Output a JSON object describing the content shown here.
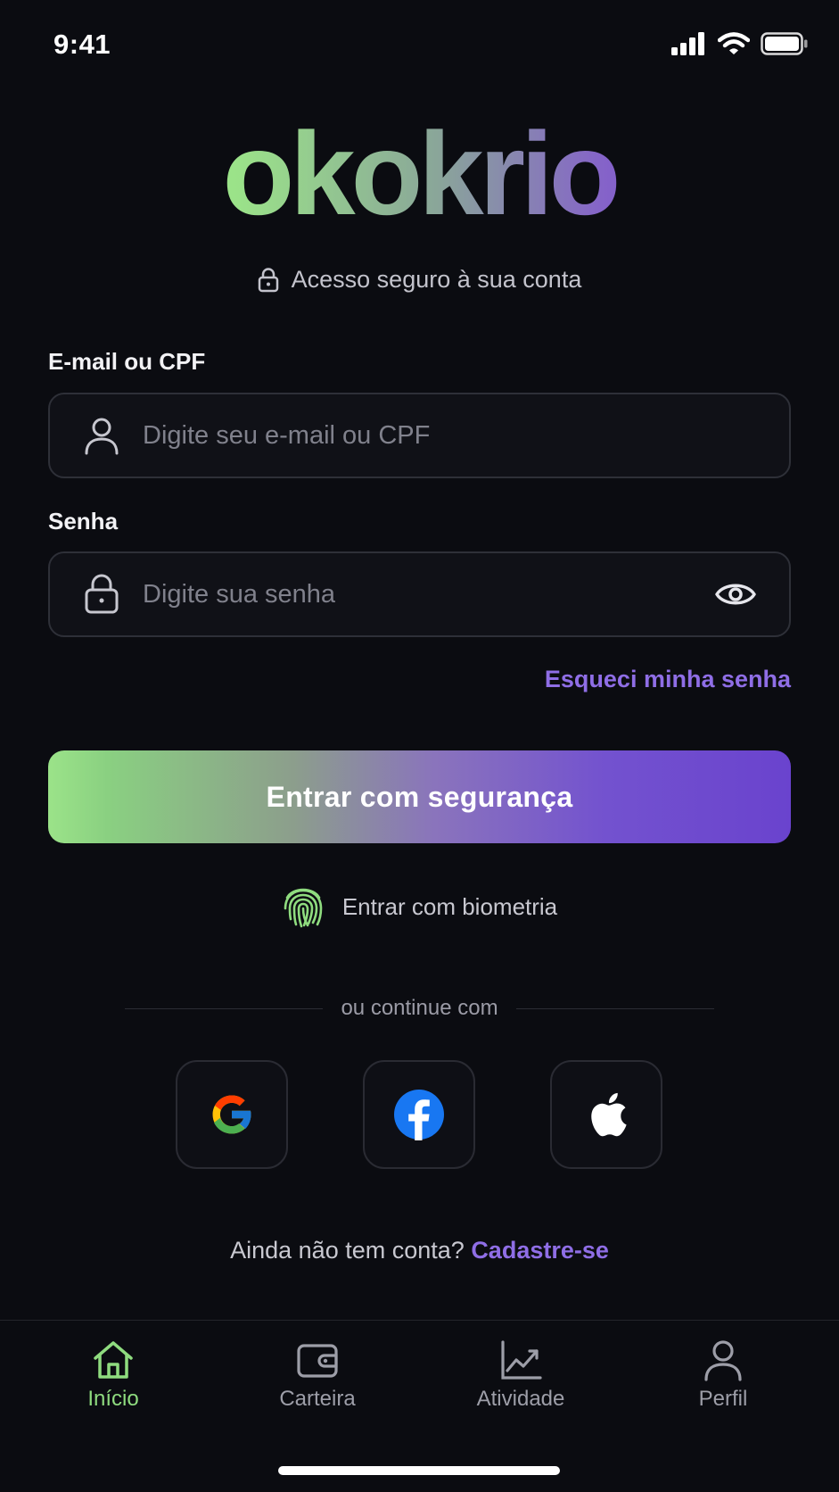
{
  "status_bar": {
    "time": "9:41"
  },
  "brand": {
    "logo_text": "okokrio",
    "gradient_start": "#9be389",
    "gradient_end": "#6b3fd0"
  },
  "subtitle": "Acesso seguro à sua conta",
  "email": {
    "label": "E-mail ou CPF",
    "placeholder": "Digite seu e-mail ou CPF",
    "value": ""
  },
  "password": {
    "label": "Senha",
    "placeholder": "Digite sua senha",
    "value": ""
  },
  "forgot_label": "Esqueci minha senha",
  "login_button": "Entrar com segurança",
  "biometric_label": "Entrar com biometria",
  "divider_text": "ou continue com",
  "social": [
    {
      "name": "google",
      "icon": "google-icon"
    },
    {
      "name": "facebook",
      "icon": "facebook-icon"
    },
    {
      "name": "apple",
      "icon": "apple-icon"
    }
  ],
  "signup": {
    "prompt": "Ainda não tem conta?",
    "link": "Cadastre-se"
  },
  "tabs": [
    {
      "label": "Início",
      "icon": "home-icon",
      "active": true
    },
    {
      "label": "Carteira",
      "icon": "wallet-icon",
      "active": false
    },
    {
      "label": "Atividade",
      "icon": "chart-icon",
      "active": false
    },
    {
      "label": "Perfil",
      "icon": "person-icon",
      "active": false
    }
  ],
  "colors": {
    "accent_purple": "#8f6ee6",
    "accent_green": "#8fdc7f",
    "background": "#0b0c11"
  }
}
